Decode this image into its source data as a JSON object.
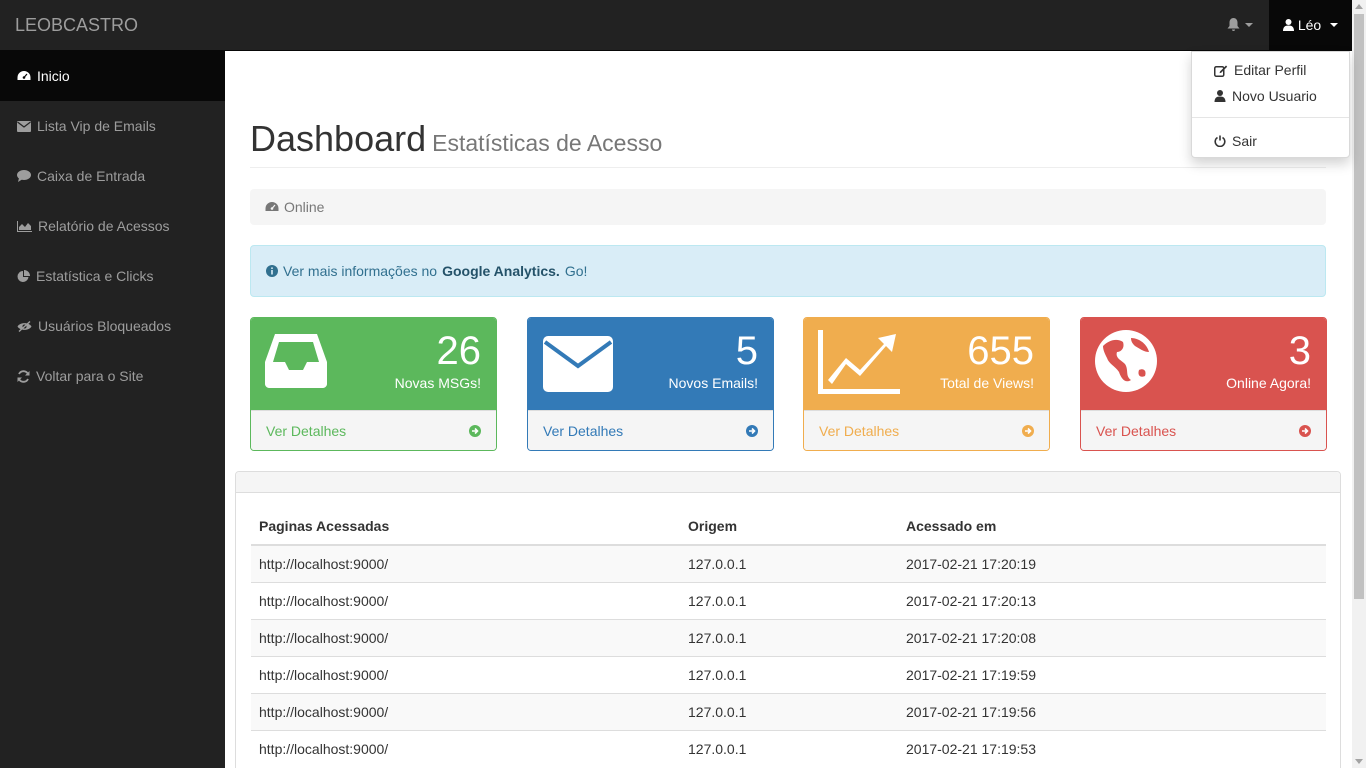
{
  "navbar": {
    "brand": "LEOBCASTRO",
    "user_label": "Léo"
  },
  "user_menu": {
    "items": [
      {
        "label": "Editar Perfil",
        "icon": "edit-icon"
      },
      {
        "label": "Novo Usuario",
        "icon": "user-icon"
      },
      {
        "label": "Sair",
        "icon": "power-icon"
      }
    ]
  },
  "sidebar": {
    "items": [
      {
        "label": "Inicio",
        "icon": "dashboard-icon",
        "active": true
      },
      {
        "label": "Lista Vip de Emails",
        "icon": "envelope-icon"
      },
      {
        "label": "Caixa de Entrada",
        "icon": "comment-icon"
      },
      {
        "label": "Relatório de Acessos",
        "icon": "area-chart-icon"
      },
      {
        "label": "Estatística e Clicks",
        "icon": "pie-chart-icon"
      },
      {
        "label": "Usuários Bloqueados",
        "icon": "eye-slash-icon"
      },
      {
        "label": "Voltar para o Site",
        "icon": "refresh-icon"
      }
    ]
  },
  "header": {
    "title": "Dashboard",
    "subtitle": "Estatísticas de Acesso"
  },
  "breadcrumb": {
    "label": "Online"
  },
  "alert": {
    "prefix": "Ver mais informações no",
    "link_bold": "Google Analytics.",
    "link": "Go!"
  },
  "panels": [
    {
      "value": "26",
      "label": "Novas MSGs!",
      "footer": "Ver Detalhes",
      "icon": "inbox-icon",
      "color": "#5cb85c"
    },
    {
      "value": "5",
      "label": "Novos Emails!",
      "footer": "Ver Detalhes",
      "icon": "envelope-icon",
      "color": "#337ab7"
    },
    {
      "value": "655",
      "label": "Total de Views!",
      "footer": "Ver Detalhes",
      "icon": "line-chart-icon",
      "color": "#f0ad4e"
    },
    {
      "value": "3",
      "label": "Online Agora!",
      "footer": "Ver Detalhes",
      "icon": "globe-icon",
      "color": "#d9534f"
    }
  ],
  "table": {
    "headers": [
      "Paginas Acessadas",
      "Origem",
      "Acessado em"
    ],
    "rows": [
      [
        "http://localhost:9000/",
        "127.0.0.1",
        "2017-02-21 17:20:19"
      ],
      [
        "http://localhost:9000/",
        "127.0.0.1",
        "2017-02-21 17:20:13"
      ],
      [
        "http://localhost:9000/",
        "127.0.0.1",
        "2017-02-21 17:20:08"
      ],
      [
        "http://localhost:9000/",
        "127.0.0.1",
        "2017-02-21 17:19:59"
      ],
      [
        "http://localhost:9000/",
        "127.0.0.1",
        "2017-02-21 17:19:56"
      ],
      [
        "http://localhost:9000/",
        "127.0.0.1",
        "2017-02-21 17:19:53"
      ]
    ]
  }
}
